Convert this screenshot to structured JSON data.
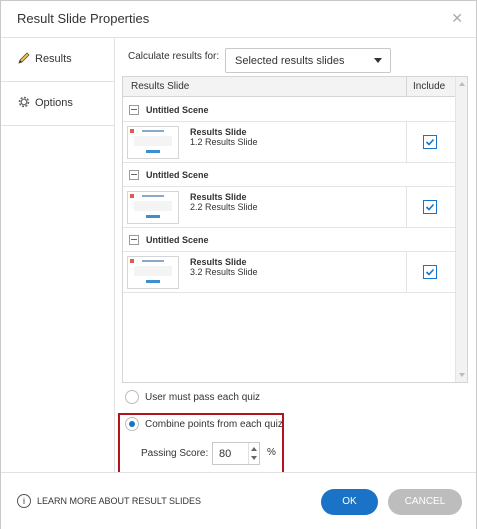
{
  "dialog": {
    "title": "Result Slide Properties"
  },
  "sidebar": {
    "items": [
      {
        "label": "Results",
        "icon": "pencil-icon",
        "active": true
      },
      {
        "label": "Options",
        "icon": "gear-icon",
        "active": false
      }
    ]
  },
  "calculate": {
    "label": "Calculate results for:",
    "selected": "Selected results slides"
  },
  "grid": {
    "col_slide": "Results Slide",
    "col_include": "Include",
    "scenes": [
      {
        "name": "Untitled Scene",
        "slide_title": "Results Slide",
        "slide_sub": "1.2 Results Slide",
        "included": true
      },
      {
        "name": "Untitled Scene",
        "slide_title": "Results Slide",
        "slide_sub": "2.2 Results Slide",
        "included": true
      },
      {
        "name": "Untitled Scene",
        "slide_title": "Results Slide",
        "slide_sub": "3.2 Results Slide",
        "included": true
      }
    ]
  },
  "options": {
    "pass_each": "User must pass each quiz",
    "combine": "Combine points from each quiz",
    "selected": "combine",
    "passing_label": "Passing Score:",
    "passing_value": "80",
    "passing_unit": "%"
  },
  "footer": {
    "learn_more": "LEARN MORE ABOUT RESULT SLIDES",
    "ok": "OK",
    "cancel": "CANCEL"
  },
  "colors": {
    "accent": "#1a73c7",
    "highlight": "#b0141d",
    "cancel": "#bdbdbd"
  }
}
